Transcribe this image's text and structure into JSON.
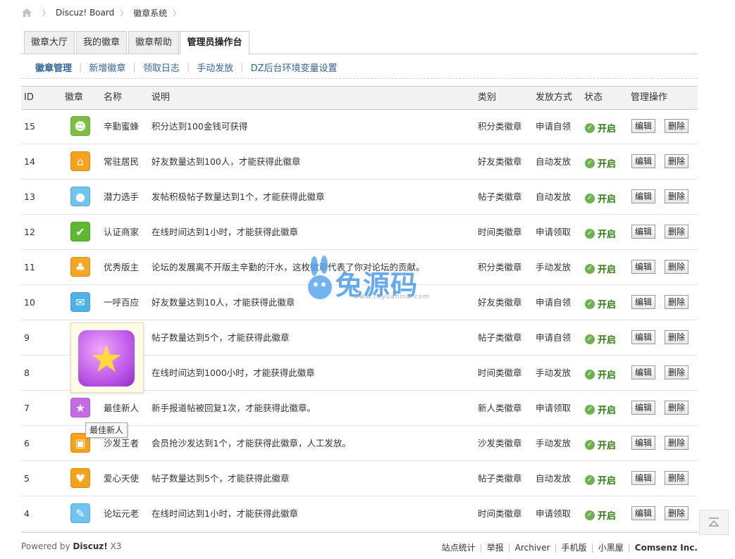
{
  "breadcrumb": {
    "board": "Discuz! Board",
    "current": "徽章系统"
  },
  "tabs": [
    "徽章大厅",
    "我的徽章",
    "徽章帮助",
    "管理员操作台"
  ],
  "subnav": [
    "徽章管理",
    "新增徽章",
    "领取日志",
    "手动发放",
    "DZ后台环境变量设置"
  ],
  "table": {
    "headers": [
      "ID",
      "徽章",
      "名称",
      "说明",
      "类别",
      "发放方式",
      "状态",
      "管理操作"
    ],
    "status_label": "开启",
    "edit_label": "编辑",
    "delete_label": "删除",
    "rows": [
      {
        "id": "15",
        "name": "辛勤蜜蜂",
        "desc": "积分达到100金钱可获得",
        "category": "积分类徽章",
        "method": "申请自领",
        "icon": "bee-icon",
        "color": "#7ac143"
      },
      {
        "id": "14",
        "name": "常驻居民",
        "desc": "好友数量达到100人，才能获得此徽章",
        "category": "好友类徽章",
        "method": "自动发放",
        "icon": "house-icon",
        "color": "#f7a21b"
      },
      {
        "id": "13",
        "name": "潜力选手",
        "desc": "发帖积极帖子数量达到1个，才能获得此徽章",
        "category": "帖子类徽章",
        "method": "自动发放",
        "icon": "fruit-icon",
        "color": "#6ec6f0"
      },
      {
        "id": "12",
        "name": "认证商家",
        "desc": "在线时间达到1小时，才能获得此徽章",
        "category": "时间类徽章",
        "method": "申请领取",
        "icon": "check-icon",
        "color": "#5fb832"
      },
      {
        "id": "11",
        "name": "优秀版主",
        "desc": "论坛的发展离不开版主辛勤的汗水，这枚徽章代表了你对论坛的贡献。",
        "category": "积分类徽章",
        "method": "手动发放",
        "icon": "bamboo-icon",
        "color": "#f5a623"
      },
      {
        "id": "10",
        "name": "一呼百应",
        "desc": "好友数量达到10人，才能获得此徽章",
        "category": "好友类徽章",
        "method": "申请自领",
        "icon": "megaphone-icon",
        "color": "#4fb3e8"
      },
      {
        "id": "9",
        "name": "",
        "desc": "帖子数量达到5个，才能获得此徽章",
        "category": "帖子类徽章",
        "method": "申请自领",
        "icon": "",
        "color": ""
      },
      {
        "id": "8",
        "name": "",
        "desc": "在线时间达到1000小时，才能获得此徽章",
        "category": "时间类徽章",
        "method": "手动发放",
        "icon": "",
        "color": ""
      },
      {
        "id": "7",
        "name": "最佳新人",
        "desc": "新手报道帖被回复1次，才能获得此徽章。",
        "category": "新人类徽章",
        "method": "申请领取",
        "icon": "star-icon",
        "color": "#c66be6"
      },
      {
        "id": "6",
        "name": "沙发王者",
        "desc": "会员抢沙发达到1个，才能获得此徽章，人工发放。",
        "category": "沙发类徽章",
        "method": "手动发放",
        "icon": "sofa-icon",
        "color": "#f7a21b"
      },
      {
        "id": "5",
        "name": "爱心天使",
        "desc": "帖子数量达到5个，才能获得此徽章",
        "category": "帖子类徽章",
        "method": "自动发放",
        "icon": "heart-icon",
        "color": "#f7a21b"
      },
      {
        "id": "4",
        "name": "论坛元老",
        "desc": "在线时间达到1小时，才能获得此徽章",
        "category": "时间类徽章",
        "method": "申请领取",
        "icon": "elder-icon",
        "color": "#6ec6f0"
      }
    ]
  },
  "tooltip": "最佳新人",
  "watermark": {
    "text": "兔源码",
    "url": "www.tuyuanma.com"
  },
  "footer": {
    "powered_prefix": "Powered by",
    "powered_brand": "Discuz!",
    "powered_version": "X3",
    "links": [
      "站点统计",
      "举报",
      "Archiver",
      "手机版",
      "小黑屋"
    ],
    "company": "Comsenz Inc."
  }
}
